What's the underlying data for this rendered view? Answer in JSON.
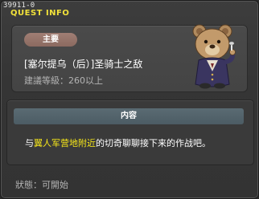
{
  "window": {
    "quest_id": "39911-0",
    "title": "QUEST INFO"
  },
  "summary": {
    "badge_label": "主要",
    "quest_name": "[塞尔提乌（后）]圣骑士之敌",
    "level_requirement": "建議等級：260以上"
  },
  "npc": {
    "icon": "bear-npc-portrait"
  },
  "content": {
    "header_label": "内容",
    "text_prefix": "与",
    "text_highlight": "翼人军营地附近",
    "text_suffix": "的切奇聊聊接下来的作战吧。"
  },
  "status": {
    "text": "狀態：可開始"
  },
  "colors": {
    "title_yellow": "#f2e23a",
    "highlight_yellow": "#f5e61a",
    "badge_brown": "#8b6a60",
    "header_blue_gray": "#4c5c64"
  }
}
